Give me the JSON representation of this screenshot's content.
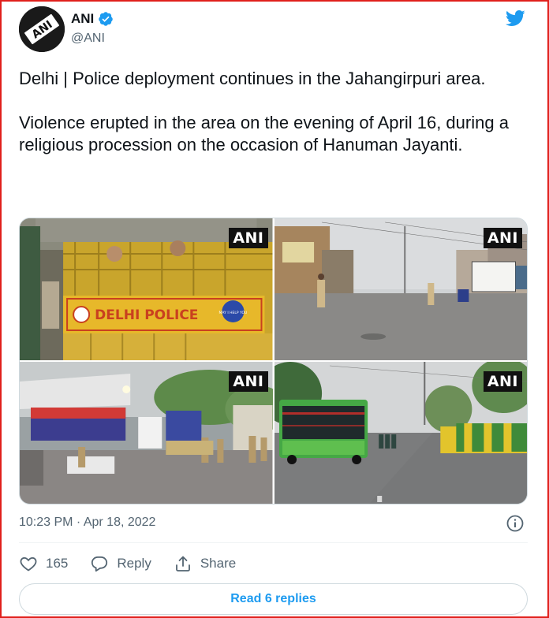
{
  "account": {
    "name": "ANI",
    "handle": "@ANI",
    "verified": true,
    "avatar_text": "ANI"
  },
  "tweet": {
    "paragraphs": [
      "Delhi | Police deployment continues in the Jahangirpuri area.",
      "Violence erupted in the area on the evening of April 16, during a religious procession on the occasion of Hanuman Jayanti."
    ],
    "timestamp": "10:23 PM · Apr 18, 2022"
  },
  "media": {
    "photos": [
      {
        "watermark": "ANI",
        "barricade_text": "DELHI POLICE",
        "badge_text": "MAY I HELP YOU"
      },
      {
        "watermark": "ANI"
      },
      {
        "watermark": "ANI"
      },
      {
        "watermark": "ANI"
      }
    ]
  },
  "actions": {
    "like_count": "165",
    "reply_label": "Reply",
    "share_label": "Share"
  },
  "read_replies_label": "Read 6 replies",
  "colors": {
    "accent": "#1d9bf0",
    "text_secondary": "#536471",
    "border": "#cfd9de",
    "frame": "#e0201c"
  },
  "icons": [
    "verified-badge-icon",
    "twitter-bird-icon",
    "info-icon",
    "heart-icon",
    "reply-icon",
    "share-icon"
  ]
}
